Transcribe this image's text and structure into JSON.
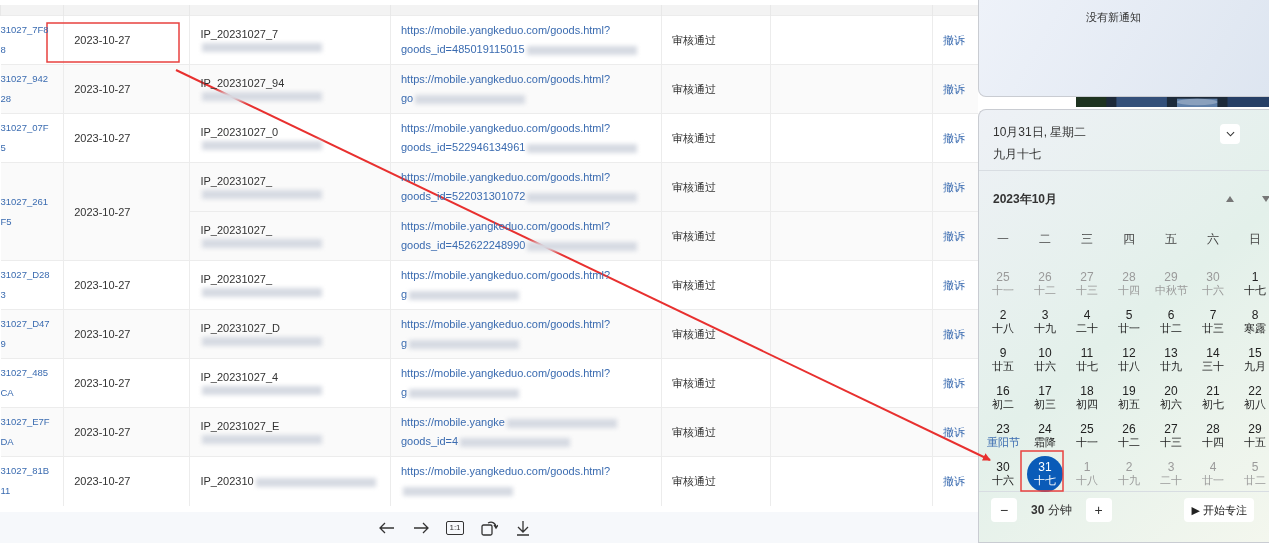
{
  "table": {
    "rows": [
      {
        "id": "31027_7F8\n8",
        "date": "2023-10-27",
        "items": [
          {
            "ip": "IP_20231027_7",
            "url": "https://mobile.yangkeduo.com/goods.html?",
            "url_tail": "goods_id=485019115015",
            "status": "审核通过",
            "action": "撤诉"
          }
        ]
      },
      {
        "id": "31027_942\n28",
        "date": "2023-10-27",
        "items": [
          {
            "ip": "IP_20231027_94",
            "url": "https://mobile.yangkeduo.com/goods.html?",
            "url_tail": "go",
            "status": "审核通过",
            "action": "撤诉"
          }
        ]
      },
      {
        "id": "31027_07F\n5",
        "date": "2023-10-27",
        "items": [
          {
            "ip": "IP_20231027_0",
            "url": "https://mobile.yangkeduo.com/goods.html?",
            "url_tail": "goods_id=522946134961",
            "status": "审核通过",
            "action": "撤诉"
          }
        ]
      },
      {
        "id": "31027_261\nF5",
        "date": "2023-10-27",
        "items": [
          {
            "ip": "IP_20231027_",
            "url": "https://mobile.yangkeduo.com/goods.html?",
            "url_tail": "goods_id=522031301072",
            "status": "审核通过",
            "action": "撤诉"
          },
          {
            "ip": "IP_20231027_",
            "url": "https://mobile.yangkeduo.com/goods.html?",
            "url_tail": "goods_id=452622248990",
            "status": "审核通过",
            "action": "撤诉"
          }
        ]
      },
      {
        "id": "31027_D28\n3",
        "date": "2023-10-27",
        "items": [
          {
            "ip": "IP_20231027_",
            "url": "https://mobile.yangkeduo.com/goods.html?",
            "url_tail": "g",
            "status": "审核通过",
            "action": "撤诉"
          }
        ]
      },
      {
        "id": "31027_D47\n9",
        "date": "2023-10-27",
        "items": [
          {
            "ip": "IP_20231027_D",
            "url": "https://mobile.yangkeduo.com/goods.html?",
            "url_tail": "g",
            "status": "审核通过",
            "action": "撤诉"
          }
        ]
      },
      {
        "id": "31027_485\nCA",
        "date": "2023-10-27",
        "items": [
          {
            "ip": "IP_20231027_4",
            "url": "https://mobile.yangkeduo.com/goods.html?",
            "url_tail": "g",
            "status": "审核通过",
            "action": "撤诉"
          }
        ]
      },
      {
        "id": "31027_E7F\nDA",
        "date": "2023-10-27",
        "items": [
          {
            "ip": "IP_20231027_E",
            "url": "https://mobile.yangke",
            "url_tail": "goods_id=4",
            "status": "审核通过",
            "action": "撤诉"
          }
        ]
      },
      {
        "id": "31027_81B\n11",
        "date": "2023-10-27",
        "items": [
          {
            "ip": "IP_202310",
            "url": "https://mobile.yangkeduo.com/goods.html?",
            "status": "审核通过",
            "action": "撤诉"
          }
        ]
      }
    ]
  },
  "viewer_toolbar": [
    {
      "kind": "back"
    },
    {
      "kind": "forward"
    },
    {
      "kind": "text",
      "label": "1:1"
    },
    {
      "kind": "rotate"
    },
    {
      "kind": "download"
    }
  ],
  "notifications": {
    "empty_text": "没有新通知"
  },
  "calendar": {
    "date_line": "10月31日, 星期二",
    "lunar_line": "九月十七",
    "month_label": "2023年10月",
    "weekdays": [
      "一",
      "二",
      "三",
      "四",
      "五",
      "六",
      "日"
    ],
    "days": [
      {
        "day": "25",
        "lunar": "十一",
        "muted": true,
        "selected": false,
        "festival": false
      },
      {
        "day": "26",
        "lunar": "十二",
        "muted": true,
        "selected": false,
        "festival": false
      },
      {
        "day": "27",
        "lunar": "十三",
        "muted": true,
        "selected": false,
        "festival": false
      },
      {
        "day": "28",
        "lunar": "十四",
        "muted": true,
        "selected": false,
        "festival": false
      },
      {
        "day": "29",
        "lunar": "中秋节",
        "muted": true,
        "selected": false,
        "festival": false
      },
      {
        "day": "30",
        "lunar": "十六",
        "muted": true,
        "selected": false,
        "festival": false
      },
      {
        "day": "1",
        "lunar": "十七",
        "muted": false,
        "selected": false,
        "festival": false
      },
      {
        "day": "2",
        "lunar": "十八",
        "muted": false,
        "selected": false,
        "festival": false
      },
      {
        "day": "3",
        "lunar": "十九",
        "muted": false,
        "selected": false,
        "festival": false
      },
      {
        "day": "4",
        "lunar": "二十",
        "muted": false,
        "selected": false,
        "festival": false
      },
      {
        "day": "5",
        "lunar": "廿一",
        "muted": false,
        "selected": false,
        "festival": false
      },
      {
        "day": "6",
        "lunar": "廿二",
        "muted": false,
        "selected": false,
        "festival": false
      },
      {
        "day": "7",
        "lunar": "廿三",
        "muted": false,
        "selected": false,
        "festival": false
      },
      {
        "day": "8",
        "lunar": "寒露",
        "muted": false,
        "selected": false,
        "festival": false
      },
      {
        "day": "9",
        "lunar": "廿五",
        "muted": false,
        "selected": false,
        "festival": false
      },
      {
        "day": "10",
        "lunar": "廿六",
        "muted": false,
        "selected": false,
        "festival": false
      },
      {
        "day": "11",
        "lunar": "廿七",
        "muted": false,
        "selected": false,
        "festival": false
      },
      {
        "day": "12",
        "lunar": "廿八",
        "muted": false,
        "selected": false,
        "festival": false
      },
      {
        "day": "13",
        "lunar": "廿九",
        "muted": false,
        "selected": false,
        "festival": false
      },
      {
        "day": "14",
        "lunar": "三十",
        "muted": false,
        "selected": false,
        "festival": false
      },
      {
        "day": "15",
        "lunar": "九月",
        "muted": false,
        "selected": false,
        "festival": false
      },
      {
        "day": "16",
        "lunar": "初二",
        "muted": false,
        "selected": false,
        "festival": false
      },
      {
        "day": "17",
        "lunar": "初三",
        "muted": false,
        "selected": false,
        "festival": false
      },
      {
        "day": "18",
        "lunar": "初四",
        "muted": false,
        "selected": false,
        "festival": false
      },
      {
        "day": "19",
        "lunar": "初五",
        "muted": false,
        "selected": false,
        "festival": false
      },
      {
        "day": "20",
        "lunar": "初六",
        "muted": false,
        "selected": false,
        "festival": false
      },
      {
        "day": "21",
        "lunar": "初七",
        "muted": false,
        "selected": false,
        "festival": false
      },
      {
        "day": "22",
        "lunar": "初八",
        "muted": false,
        "selected": false,
        "festival": false
      },
      {
        "day": "23",
        "lunar": "重阳节",
        "muted": false,
        "selected": false,
        "festival": true
      },
      {
        "day": "24",
        "lunar": "霜降",
        "muted": false,
        "selected": false,
        "festival": false
      },
      {
        "day": "25",
        "lunar": "十一",
        "muted": false,
        "selected": false,
        "festival": false
      },
      {
        "day": "26",
        "lunar": "十二",
        "muted": false,
        "selected": false,
        "festival": false
      },
      {
        "day": "27",
        "lunar": "十三",
        "muted": false,
        "selected": false,
        "festival": false
      },
      {
        "day": "28",
        "lunar": "十四",
        "muted": false,
        "selected": false,
        "festival": false
      },
      {
        "day": "29",
        "lunar": "十五",
        "muted": false,
        "selected": false,
        "festival": false
      },
      {
        "day": "30",
        "lunar": "十六",
        "muted": false,
        "selected": false,
        "festival": false
      },
      {
        "day": "31",
        "lunar": "十七",
        "muted": false,
        "selected": true,
        "festival": false
      },
      {
        "day": "1",
        "lunar": "十八",
        "muted": true,
        "selected": false,
        "festival": false
      },
      {
        "day": "2",
        "lunar": "十九",
        "muted": true,
        "selected": false,
        "festival": false
      },
      {
        "day": "3",
        "lunar": "二十",
        "muted": true,
        "selected": false,
        "festival": false
      },
      {
        "day": "4",
        "lunar": "廿一",
        "muted": true,
        "selected": false,
        "festival": false
      },
      {
        "day": "5",
        "lunar": "廿二",
        "muted": true,
        "selected": false,
        "festival": false
      }
    ]
  },
  "focus": {
    "minus": "−",
    "duration": "**30** 分钟",
    "plus": "+",
    "start_button": "▶ 开始专注"
  }
}
